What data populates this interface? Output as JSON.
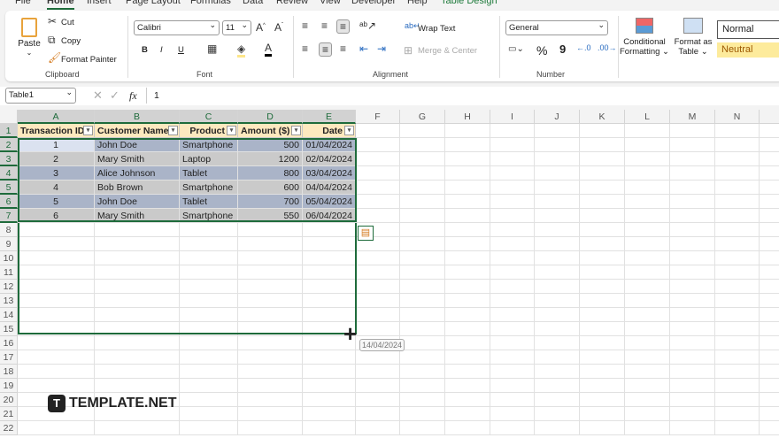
{
  "tabs": [
    "File",
    "Home",
    "Insert",
    "Page Layout",
    "Formulas",
    "Data",
    "Review",
    "View",
    "Developer",
    "Help",
    "Table Design"
  ],
  "clipboard": {
    "paste": "Paste",
    "cut": "Cut",
    "copy": "Copy",
    "format_painter": "Format Painter",
    "group": "Clipboard"
  },
  "font": {
    "name": "Calibri",
    "size": "11",
    "group": "Font",
    "bold": "B",
    "italic": "I",
    "underline": "U"
  },
  "alignment": {
    "wrap": "Wrap Text",
    "merge": "Merge & Center",
    "group": "Alignment"
  },
  "number": {
    "format": "General",
    "group": "Number",
    "percent": "%",
    "comma": "9"
  },
  "styles": {
    "conditional": "Conditional",
    "conditional2": "Formatting ⌄",
    "format_as": "Format as",
    "format_as2": "Table ⌄",
    "normal": "Normal",
    "neutral": "Neutral"
  },
  "formula_bar": {
    "name_box": "Table1",
    "fx": "fx",
    "value": "1"
  },
  "columns": [
    "A",
    "B",
    "C",
    "D",
    "E",
    "F",
    "G",
    "H",
    "I",
    "J",
    "K",
    "L",
    "M",
    "N"
  ],
  "table": {
    "headers": [
      "Transaction ID",
      "Customer Name",
      "Product",
      "Amount ($)",
      "Date"
    ],
    "rows": [
      [
        "1",
        "John Doe",
        "Smartphone",
        "500",
        "01/04/2024"
      ],
      [
        "2",
        "Mary Smith",
        "Laptop",
        "1200",
        "02/04/2024"
      ],
      [
        "3",
        "Alice Johnson",
        "Tablet",
        "800",
        "03/04/2024"
      ],
      [
        "4",
        "Bob Brown",
        "Smartphone",
        "600",
        "04/04/2024"
      ],
      [
        "5",
        "John Doe",
        "Tablet",
        "700",
        "05/04/2024"
      ],
      [
        "6",
        "Mary Smith",
        "Smartphone",
        "550",
        "06/04/2024"
      ]
    ]
  },
  "fill_tooltip": "14/04/2024",
  "watermark": "TEMPLATE.NET",
  "colors": {
    "accent": "#1e6b3b",
    "band1": "#aab4c8",
    "band2": "#cacaca",
    "header": "#fde9bf"
  }
}
